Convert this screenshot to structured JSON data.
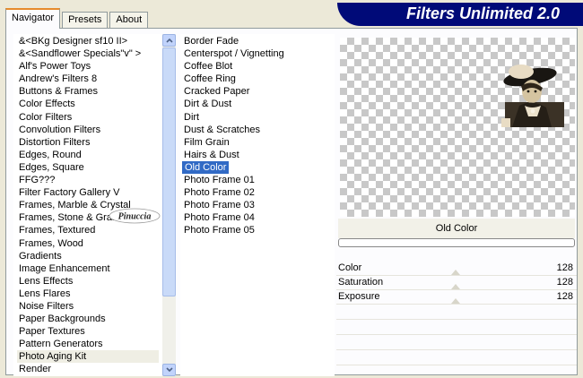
{
  "tabs": [
    "Navigator",
    "Presets",
    "About"
  ],
  "banner_title": "Filters Unlimited 2.0",
  "categories": [
    "&<BKg Designer sf10 II>",
    "&<Sandflower Specials\"v\" >",
    "Alf's Power Toys",
    "Andrew's Filters 8",
    "Buttons & Frames",
    "Color Effects",
    "Color Filters",
    "Convolution Filters",
    "Distortion Filters",
    "Edges, Round",
    "Edges, Square",
    "FFG???",
    "Filter Factory Gallery V",
    "Frames, Marble & Crystal",
    "Frames, Stone & Granite",
    "Frames, Textured",
    "Frames, Wood",
    "Gradients",
    "Image Enhancement",
    "Lens Effects",
    "Lens Flares",
    "Noise Filters",
    "Paper Backgrounds",
    "Paper Textures",
    "Pattern Generators",
    "Photo Aging Kit",
    "Render"
  ],
  "filters": [
    "Border Fade",
    "Centerspot / Vignetting",
    "Coffee Blot",
    "Coffee Ring",
    "Cracked Paper",
    "Dirt & Dust",
    "Dirt",
    "Dust & Scratches",
    "Film Grain",
    "Hairs & Dust",
    "Old Color",
    "Photo Frame 01",
    "Photo Frame 02",
    "Photo Frame 03",
    "Photo Frame 04",
    "Photo Frame 05"
  ],
  "selected_filter": "Old Color",
  "selected_category": "Photo Aging Kit",
  "watermark": "Pinuccia",
  "filter_name": "Old Color",
  "sliders": [
    {
      "label": "Color",
      "value": "128"
    },
    {
      "label": "Saturation",
      "value": "128"
    },
    {
      "label": "Exposure",
      "value": "128"
    }
  ],
  "colors": {
    "selection": "#316ac5",
    "banner": "#000a78",
    "tab_accent": "#e68b2c"
  }
}
